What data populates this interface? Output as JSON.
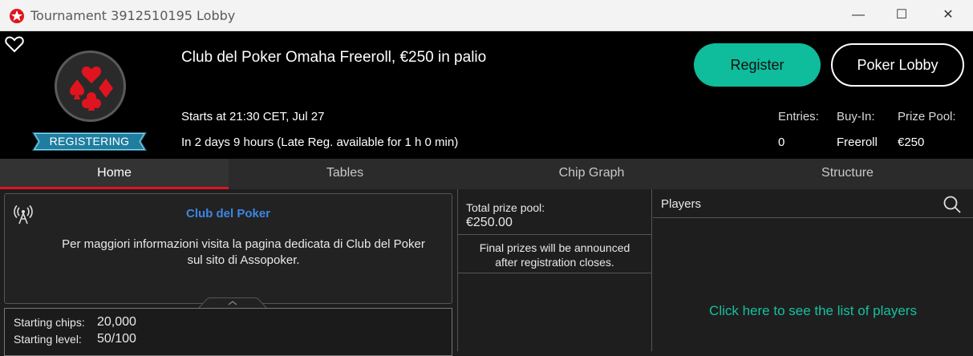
{
  "window": {
    "title": "Tournament 3912510195 Lobby",
    "controls": {
      "minimize": "—",
      "maximize": "☐",
      "close": "✕"
    }
  },
  "header": {
    "status_badge": "REGISTERING",
    "tournament_name": "Club del Poker Omaha Freeroll, €250 in palio",
    "starts": "Starts at 21:30 CET, Jul 27",
    "time_left": "In 2 days 9 hours (Late Reg. available for 1 h 0 min)",
    "register_label": "Register",
    "lobby_label": "Poker Lobby",
    "stats": {
      "entries_label": "Entries:",
      "entries_value": "0",
      "buyin_label": "Buy-In:",
      "buyin_value": "Freeroll",
      "prize_label": "Prize Pool:",
      "prize_value": "€250"
    }
  },
  "tabs": [
    {
      "label": "Home",
      "active": true
    },
    {
      "label": "Tables",
      "active": false
    },
    {
      "label": "Chip Graph",
      "active": false
    },
    {
      "label": "Structure",
      "active": false
    }
  ],
  "info": {
    "title": "Club del Poker",
    "text_line1": "Per maggiori informazioni visita la pagina dedicata di Club del Poker",
    "text_line2": "sul sito di Assopoker."
  },
  "chips": {
    "starting_chips_label": "Starting chips:",
    "starting_chips_value": "20,000",
    "starting_level_label": "Starting level:",
    "starting_level_value": "50/100"
  },
  "prize": {
    "total_label": "Total prize pool:",
    "total_value": "€250.00",
    "note_line1": "Final prizes will be announced",
    "note_line2": "after registration closes."
  },
  "players": {
    "title": "Players",
    "link": "Click here to see the list of players"
  },
  "colors": {
    "accent_green": "#0fbc9b",
    "accent_red": "#e0141e",
    "link_blue": "#3b86e3",
    "ribbon_blue": "#1f7ea0"
  }
}
